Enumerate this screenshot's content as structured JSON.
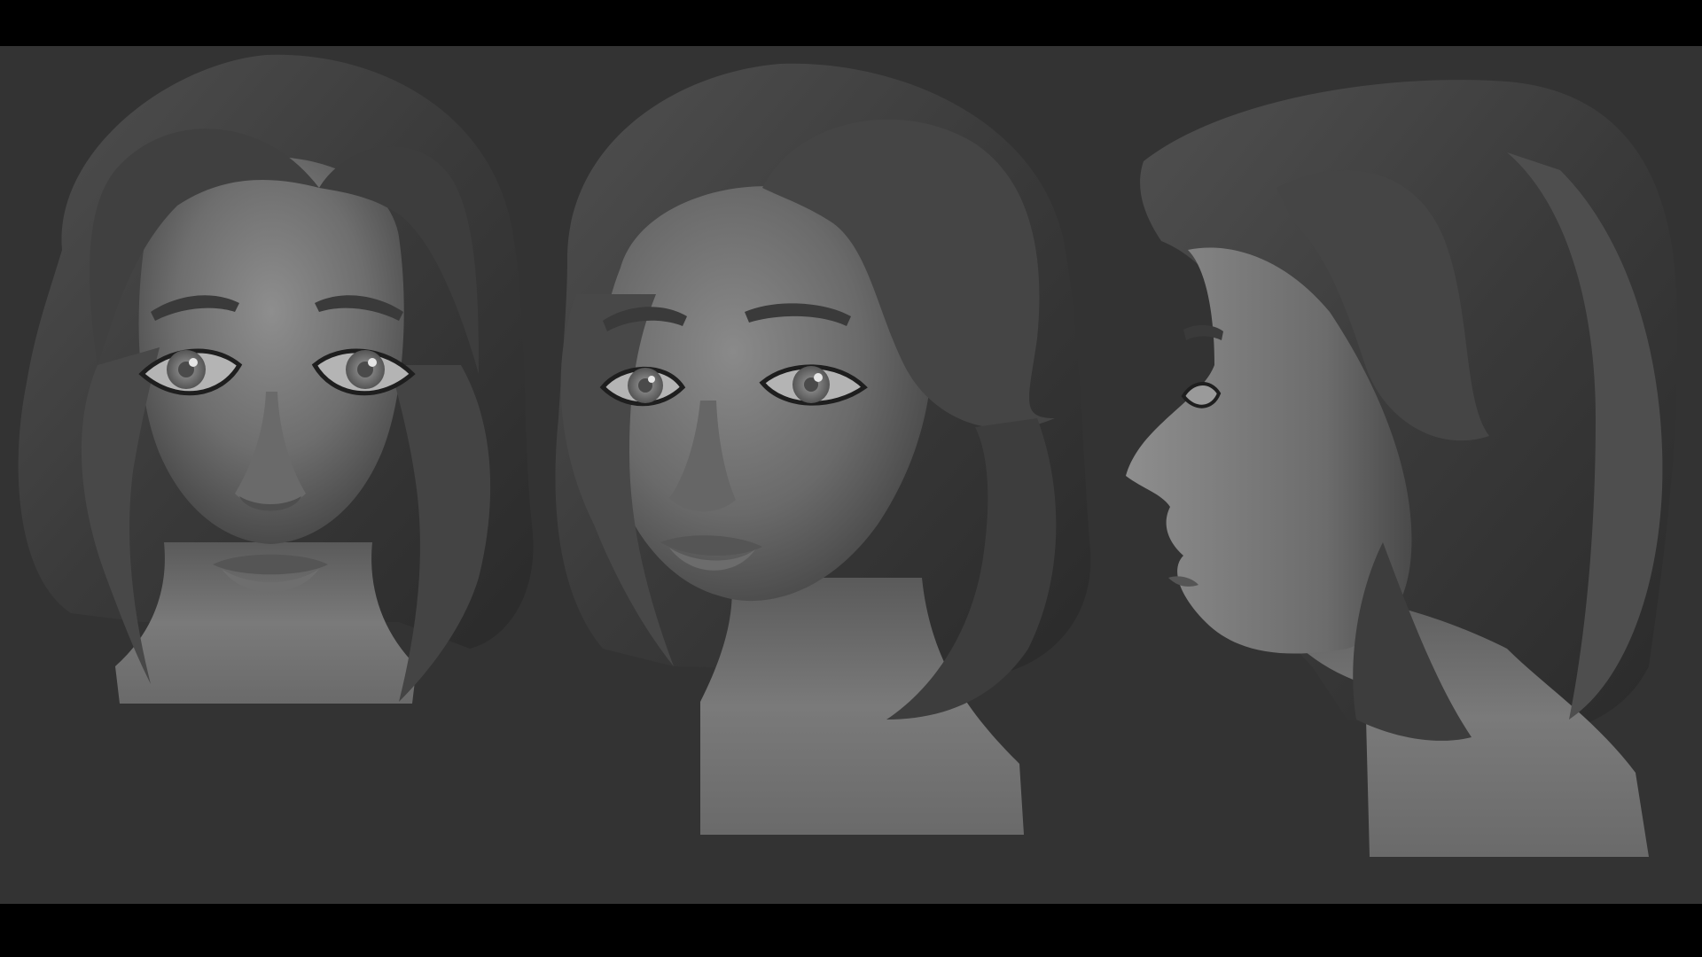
{
  "scene": {
    "description_free": true,
    "background_color": "#333333",
    "letterbox_color": "#000000",
    "views": [
      {
        "id": "front",
        "name": "front-view"
      },
      {
        "id": "three-quarter",
        "name": "three-quarter-view"
      },
      {
        "id": "profile",
        "name": "profile-view"
      }
    ],
    "colors": {
      "hair_dark": "#2e2e2e",
      "hair_mid": "#474747",
      "hair_light": "#5e5e5e",
      "skin_light": "#8c8c8c",
      "skin_mid": "#6a6a6a",
      "skin_dark": "#4a4a4a",
      "iris": "#7a7a7a",
      "sclera": "#b4b4b4"
    }
  }
}
